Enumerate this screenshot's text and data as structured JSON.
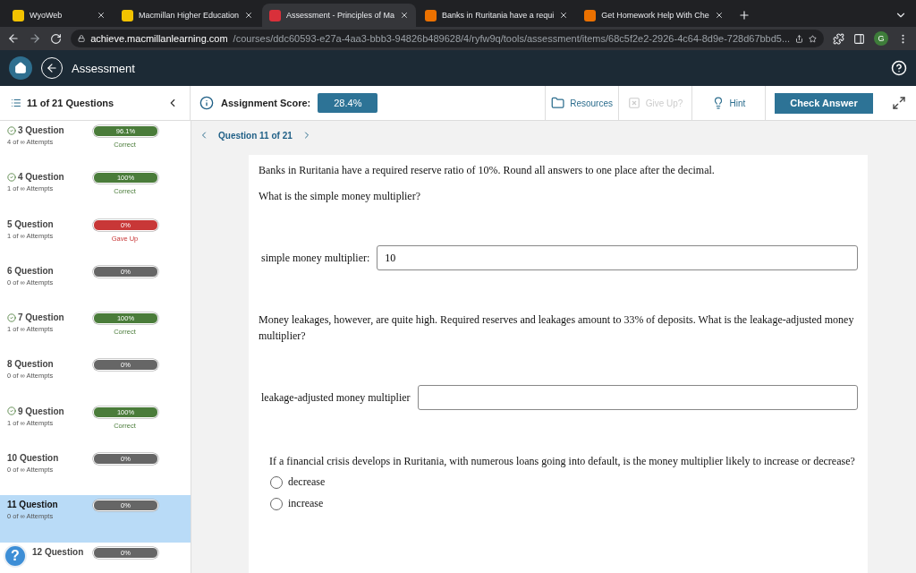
{
  "browser": {
    "tabs": [
      {
        "title": "WyoWeb",
        "selected": false
      },
      {
        "title": "Macmillan Higher Education",
        "selected": false
      },
      {
        "title": "Assessment - Principles of Ma",
        "selected": true
      },
      {
        "title": "Banks in Ruritania have a requi",
        "selected": false
      },
      {
        "title": "Get Homework Help With Che",
        "selected": false
      }
    ],
    "url_host": "achieve.macmillanlearning.com",
    "url_path": "/courses/ddc60593-e27a-4aa3-bbb3-94826b489628/4/ryfw9q/tools/assessment/items/68c5f2e2-2926-4c64-8d9e-728d67bbd5...",
    "profile_initial": "G"
  },
  "header": {
    "title": "Assessment"
  },
  "toolbar": {
    "questions_label": "11 of 21 Questions",
    "score_label": "Assignment Score:",
    "score_value": "28.4%",
    "actions": [
      {
        "label": "Resources",
        "disabled": false
      },
      {
        "label": "Give Up?",
        "disabled": true
      },
      {
        "label": "Hint",
        "disabled": false
      }
    ],
    "check_button": "Check Answer"
  },
  "sidebar": {
    "items": [
      {
        "title": "3 Question",
        "attempts": "4 of ∞ Attempts",
        "score": "96.1%",
        "status": "Correct",
        "kind": "correct",
        "checked": true,
        "selected": false
      },
      {
        "title": "4 Question",
        "attempts": "1 of ∞ Attempts",
        "score": "100%",
        "status": "Correct",
        "kind": "correct",
        "checked": true,
        "selected": false
      },
      {
        "title": "5 Question",
        "attempts": "1 of ∞ Attempts",
        "score": "0%",
        "status": "Gave Up",
        "kind": "gaveup",
        "checked": false,
        "selected": false
      },
      {
        "title": "6 Question",
        "attempts": "0 of ∞ Attempts",
        "score": "0%",
        "kind": "none",
        "checked": false,
        "selected": false
      },
      {
        "title": "7 Question",
        "attempts": "1 of ∞ Attempts",
        "score": "100%",
        "status": "Correct",
        "kind": "correct",
        "checked": true,
        "selected": false
      },
      {
        "title": "8 Question",
        "attempts": "0 of ∞ Attempts",
        "score": "0%",
        "kind": "none",
        "checked": false,
        "selected": false
      },
      {
        "title": "9 Question",
        "attempts": "1 of ∞ Attempts",
        "score": "100%",
        "status": "Correct",
        "kind": "correct",
        "checked": true,
        "selected": false
      },
      {
        "title": "10 Question",
        "attempts": "0 of ∞ Attempts",
        "score": "0%",
        "kind": "none",
        "checked": false,
        "selected": false
      },
      {
        "title": "11 Question",
        "attempts": "0 of ∞ Attempts",
        "score": "0%",
        "kind": "none",
        "checked": false,
        "selected": true
      },
      {
        "title": "12 Question",
        "score": "0%",
        "kind": "none",
        "checked": false,
        "selected": false
      }
    ],
    "help": "?"
  },
  "question": {
    "nav": "Question 11 of 21",
    "blocks": [
      {
        "kind": "text",
        "text": "Banks in Ruritania have a required reserve ratio of 10%. Round all answers to one place after the decimal."
      },
      {
        "kind": "text",
        "text": "What is the simple money multiplier?"
      },
      {
        "kind": "input",
        "label": "simple money multiplier:",
        "value": "10"
      },
      {
        "kind": "text",
        "text": "Money leakages, however, are quite high. Required reserves and leakages amount to 33% of deposits. What is the leakage-adjusted money multiplier?"
      },
      {
        "kind": "input",
        "label": "leakage-adjusted money multiplier"
      },
      {
        "kind": "choice",
        "text": "If a financial crisis develops in Ruritania, with numerous loans going into default, is the money multiplier likely to increase or decrease?",
        "options": [
          {
            "label": "decrease",
            "selected": false
          },
          {
            "label": "increase",
            "selected": false
          }
        ]
      }
    ]
  }
}
